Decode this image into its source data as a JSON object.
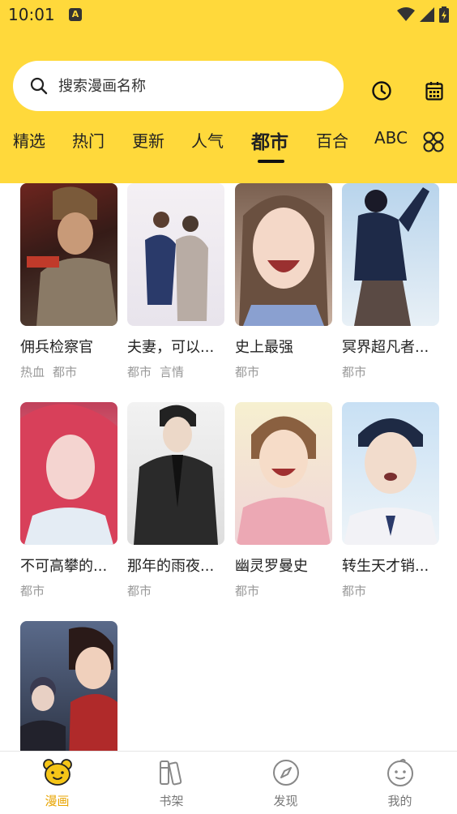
{
  "status_bar": {
    "time": "10:01",
    "notification_badge": "A"
  },
  "search": {
    "placeholder": "搜索漫画名称"
  },
  "header_icons": [
    "history-icon",
    "calendar-icon"
  ],
  "tabs": [
    {
      "label": "精选"
    },
    {
      "label": "热门"
    },
    {
      "label": "更新"
    },
    {
      "label": "人气"
    },
    {
      "label": "都市",
      "active": true
    },
    {
      "label": "百合"
    },
    {
      "label": "ABC"
    }
  ],
  "comics": [
    {
      "title": "佣兵检察官",
      "tags": [
        "热血",
        "都市"
      ]
    },
    {
      "title": "夫妻，可以...",
      "tags": [
        "都市",
        "言情"
      ]
    },
    {
      "title": "史上最强",
      "tags": [
        "都市"
      ]
    },
    {
      "title": "冥界超凡者...",
      "tags": [
        "都市"
      ]
    },
    {
      "title": "不可高攀的...",
      "tags": [
        "都市"
      ]
    },
    {
      "title": "那年的雨夜...",
      "tags": [
        "都市"
      ]
    },
    {
      "title": "幽灵罗曼史",
      "tags": [
        "都市"
      ]
    },
    {
      "title": "转生天才销...",
      "tags": [
        "都市"
      ]
    },
    {
      "title": "",
      "tags": []
    }
  ],
  "bottom_nav": [
    {
      "label": "漫画",
      "icon": "bear-icon",
      "active": true
    },
    {
      "label": "书架",
      "icon": "bookshelf-icon"
    },
    {
      "label": "发现",
      "icon": "compass-icon"
    },
    {
      "label": "我的",
      "icon": "face-icon"
    }
  ],
  "colors": {
    "accent": "#FFD93B",
    "active_nav": "#E8A400",
    "tag_gray": "#999999"
  }
}
